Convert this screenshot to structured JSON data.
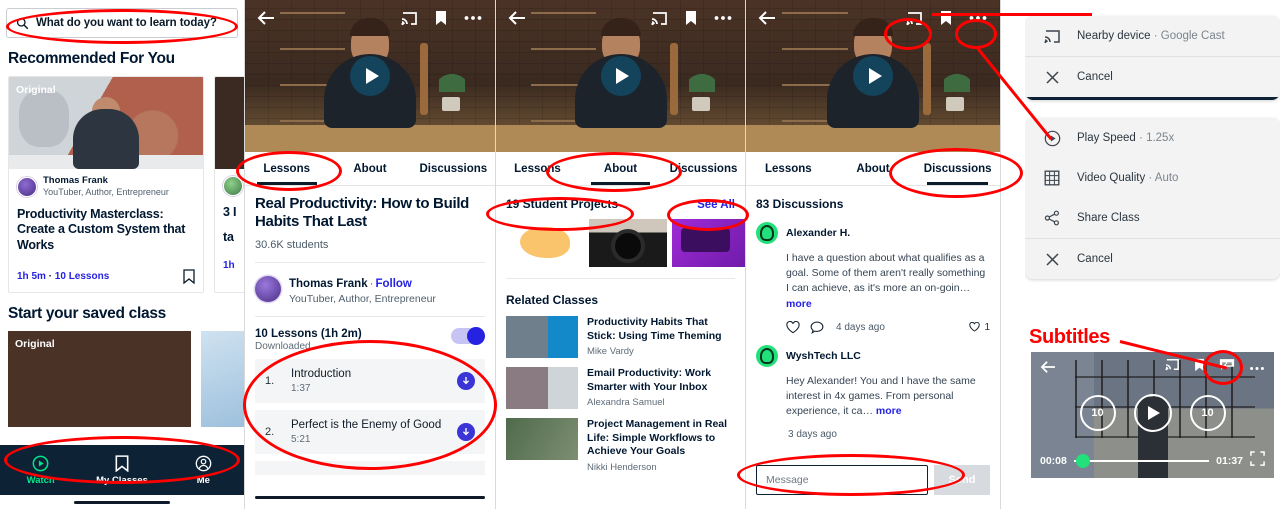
{
  "home": {
    "search": {
      "placeholder": "What do you want to learn today?",
      "icon": "search-icon"
    },
    "section_recommended": "Recommended For You",
    "section_saved": "Start your saved class",
    "badge_original": "Original",
    "card": {
      "teacher_name": "Thomas Frank",
      "teacher_role": "YouTuber, Author, Entrepreneur",
      "title": "Productivity Masterclass: Create a Custom System that Works",
      "duration": "1h 5m",
      "dot": " · ",
      "lessons": "10 Lessons",
      "bookmark_icon": "bookmark-icon"
    },
    "card_partial": {
      "title_fragment": "3 I",
      "title_fragment2": "ta",
      "duration": "1h"
    },
    "nav": [
      {
        "label": "Watch",
        "icon": "play-circle-icon",
        "active": true
      },
      {
        "label": "My Classes",
        "icon": "bookmark-icon",
        "active": false
      },
      {
        "label": "Me",
        "icon": "person-circle-icon",
        "active": false
      }
    ]
  },
  "player": {
    "back_icon": "back-arrow-icon",
    "cast_icon": "cast-icon",
    "bookmark_icon": "bookmark-icon",
    "overflow_icon": "more-options-icon",
    "play_icon": "play-icon"
  },
  "tabs": {
    "lessons": "Lessons",
    "about": "About",
    "discussions": "Discussions"
  },
  "lessons_tab": {
    "class_title": "Real Productivity: How to Build Habits That Last",
    "students": "30.6K students",
    "teacher_name": "Thomas Frank",
    "follow": "Follow",
    "teacher_role": "YouTuber, Author, Entrepreneur",
    "lessons_header": "10 Lessons (1h 2m)",
    "downloaded_label": "Downloaded",
    "items": [
      {
        "num": "1.",
        "title": "Introduction",
        "time": "1:37",
        "download_icon": "download-icon"
      },
      {
        "num": "2.",
        "title": "Perfect is the Enemy of Good",
        "time": "5:21",
        "download_icon": "download-icon"
      }
    ]
  },
  "about_tab": {
    "projects_title": "19 Student Projects",
    "see_all": "See All",
    "related_title": "Related Classes",
    "related": [
      {
        "name": "Productivity Habits That Stick: Using Time Theming",
        "author": "Mike Vardy"
      },
      {
        "name": "Email Productivity: Work Smarter with Your Inbox",
        "author": "Alexandra Samuel"
      },
      {
        "name": "Project Management in Real Life: Simple Workflows to Achieve Your Goals",
        "author": "Nikki Henderson"
      }
    ]
  },
  "discussions_tab": {
    "count": "83 Discussions",
    "posts": [
      {
        "author": "Alexander H.",
        "body": "I have a question about what qualifies as a goal. Some of them aren't really something I can achieve, as it's more an on-goin…",
        "more": "more",
        "timestamp": "4 days ago",
        "likes": "1",
        "like_icon": "heart-icon",
        "comment_icon": "comment-icon"
      },
      {
        "author": "WyshTech LLC",
        "body": "Hey Alexander! You and I have the same interest in 4x games. From personal experience, it ca…",
        "more": "more",
        "timestamp": "3 days ago"
      }
    ],
    "message_placeholder": "Message",
    "send_label": "Send"
  },
  "cast_sheet": {
    "items": [
      {
        "label": "Nearby device",
        "dot": " · ",
        "value": "Google Cast",
        "icon": "cast-icon"
      },
      {
        "label": "Cancel",
        "icon": "close-icon"
      }
    ]
  },
  "options_sheet": {
    "items": [
      {
        "label": "Play Speed",
        "dot": " · ",
        "value": "1.25x",
        "icon": "play-circle-icon"
      },
      {
        "label": "Video Quality",
        "dot": " · ",
        "value": "Auto",
        "icon": "film-icon"
      },
      {
        "label": "Share Class",
        "icon": "share-icon"
      },
      {
        "label": "Cancel",
        "icon": "close-icon"
      }
    ]
  },
  "annotation": {
    "subtitles_label": "Subtitles",
    "color": "#ff0000"
  },
  "mini_player": {
    "back_icon": "back-arrow-icon",
    "cast_icon": "cast-icon",
    "bookmark_icon": "bookmark-icon",
    "subtitles_icon": "subtitles-icon",
    "overflow_icon": "more-options-icon",
    "rewind_label": "10",
    "forward_label": "10",
    "current_time": "00:08",
    "total_time": "01:37",
    "fullscreen_icon": "fullscreen-icon"
  }
}
